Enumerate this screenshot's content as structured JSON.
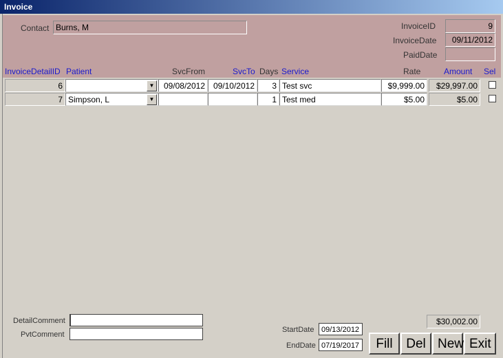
{
  "window": {
    "title": "Invoice"
  },
  "header": {
    "contact_label": "Contact",
    "contact_value": "Burns, M",
    "invoice_id_label": "InvoiceID",
    "invoice_id_value": "9",
    "invoice_date_label": "InvoiceDate",
    "invoice_date_value": "09/11/2012",
    "paid_date_label": "PaidDate",
    "paid_date_value": ""
  },
  "columns": {
    "invoice_detail_id": "InvoiceDetailID",
    "patient": "Patient",
    "svc_from": "SvcFrom",
    "svc_to": "SvcTo",
    "days": "Days",
    "service": "Service",
    "rate": "Rate",
    "amount": "Amount",
    "sel": "Sel"
  },
  "rows": [
    {
      "id": "6",
      "patient": "",
      "svc_from": "09/08/2012",
      "svc_to": "09/10/2012",
      "days": "3",
      "service": "Test svc",
      "rate": "$9,999.00",
      "amount": "$29,997.00",
      "sel": false
    },
    {
      "id": "7",
      "patient": "Simpson, L",
      "svc_from": "",
      "svc_to": "",
      "days": "1",
      "service": "Test med",
      "rate": "$5.00",
      "amount": "$5.00",
      "sel": false
    }
  ],
  "footer": {
    "detail_comment_label": "DetailComment",
    "detail_comment_value": "",
    "pvt_comment_label": "PvtComment",
    "pvt_comment_value": "",
    "start_date_label": "StartDate",
    "start_date_value": "09/13/2012",
    "end_date_label": "EndDate",
    "end_date_value": "07/19/2017",
    "total": "$30,002.00"
  },
  "buttons": {
    "fill": "Fill",
    "del": "Del",
    "new": "New",
    "exit": "Exit"
  },
  "colors": {
    "header_bg": "#c0a0a0",
    "form_bg": "#d4d0c8",
    "title_start": "#0a246a",
    "title_end": "#a6caf0",
    "column_blue": "#1a1acc"
  }
}
